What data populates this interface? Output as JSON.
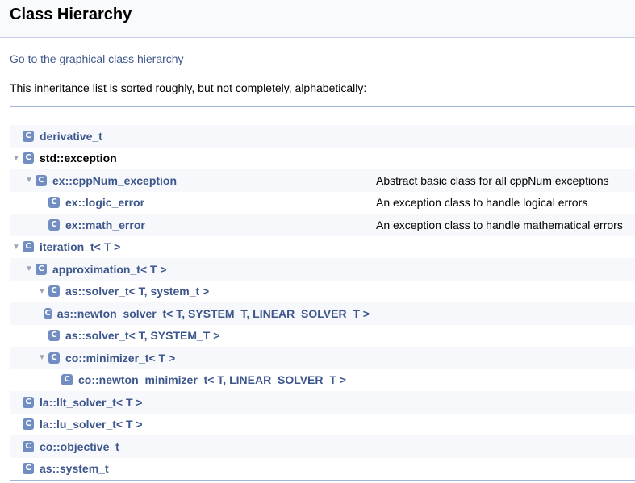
{
  "header": {
    "title": "Class Hierarchy"
  },
  "graph_link": "Go to the graphical class hierarchy",
  "intro": "This inheritance list is sorted roughly, but not completely, alphabetically:",
  "class_icon_letter": "C",
  "rows": [
    {
      "name": "derivative_t",
      "desc": "",
      "level": 0,
      "expander": false,
      "link": true
    },
    {
      "name": "std::exception",
      "desc": "",
      "level": 0,
      "expander": true,
      "link": false
    },
    {
      "name": "ex::cppNum_exception",
      "desc": "Abstract basic class for all cppNum exceptions",
      "level": 1,
      "expander": true,
      "link": true
    },
    {
      "name": "ex::logic_error",
      "desc": "An exception class to handle logical errors",
      "level": 2,
      "expander": false,
      "link": true
    },
    {
      "name": "ex::math_error",
      "desc": "An exception class to handle mathematical errors",
      "level": 2,
      "expander": false,
      "link": true
    },
    {
      "name": "iteration_t< T >",
      "desc": "",
      "level": 0,
      "expander": true,
      "link": true
    },
    {
      "name": "approximation_t< T >",
      "desc": "",
      "level": 1,
      "expander": true,
      "link": true
    },
    {
      "name": "as::solver_t< T, system_t >",
      "desc": "",
      "level": 2,
      "expander": true,
      "link": true
    },
    {
      "name": "as::newton_solver_t< T, SYSTEM_T, LINEAR_SOLVER_T >",
      "desc": "",
      "level": 3,
      "expander": false,
      "link": true
    },
    {
      "name": "as::solver_t< T, SYSTEM_T >",
      "desc": "",
      "level": 2,
      "expander": false,
      "link": true
    },
    {
      "name": "co::minimizer_t< T >",
      "desc": "",
      "level": 2,
      "expander": true,
      "link": true
    },
    {
      "name": "co::newton_minimizer_t< T, LINEAR_SOLVER_T >",
      "desc": "",
      "level": 3,
      "expander": false,
      "link": true
    },
    {
      "name": "la::llt_solver_t< T >",
      "desc": "",
      "level": 0,
      "expander": false,
      "link": true
    },
    {
      "name": "la::lu_solver_t< T >",
      "desc": "",
      "level": 0,
      "expander": false,
      "link": true
    },
    {
      "name": "co::objective_t",
      "desc": "",
      "level": 0,
      "expander": false,
      "link": true
    },
    {
      "name": "as::system_t",
      "desc": "",
      "level": 0,
      "expander": false,
      "link": true
    }
  ]
}
